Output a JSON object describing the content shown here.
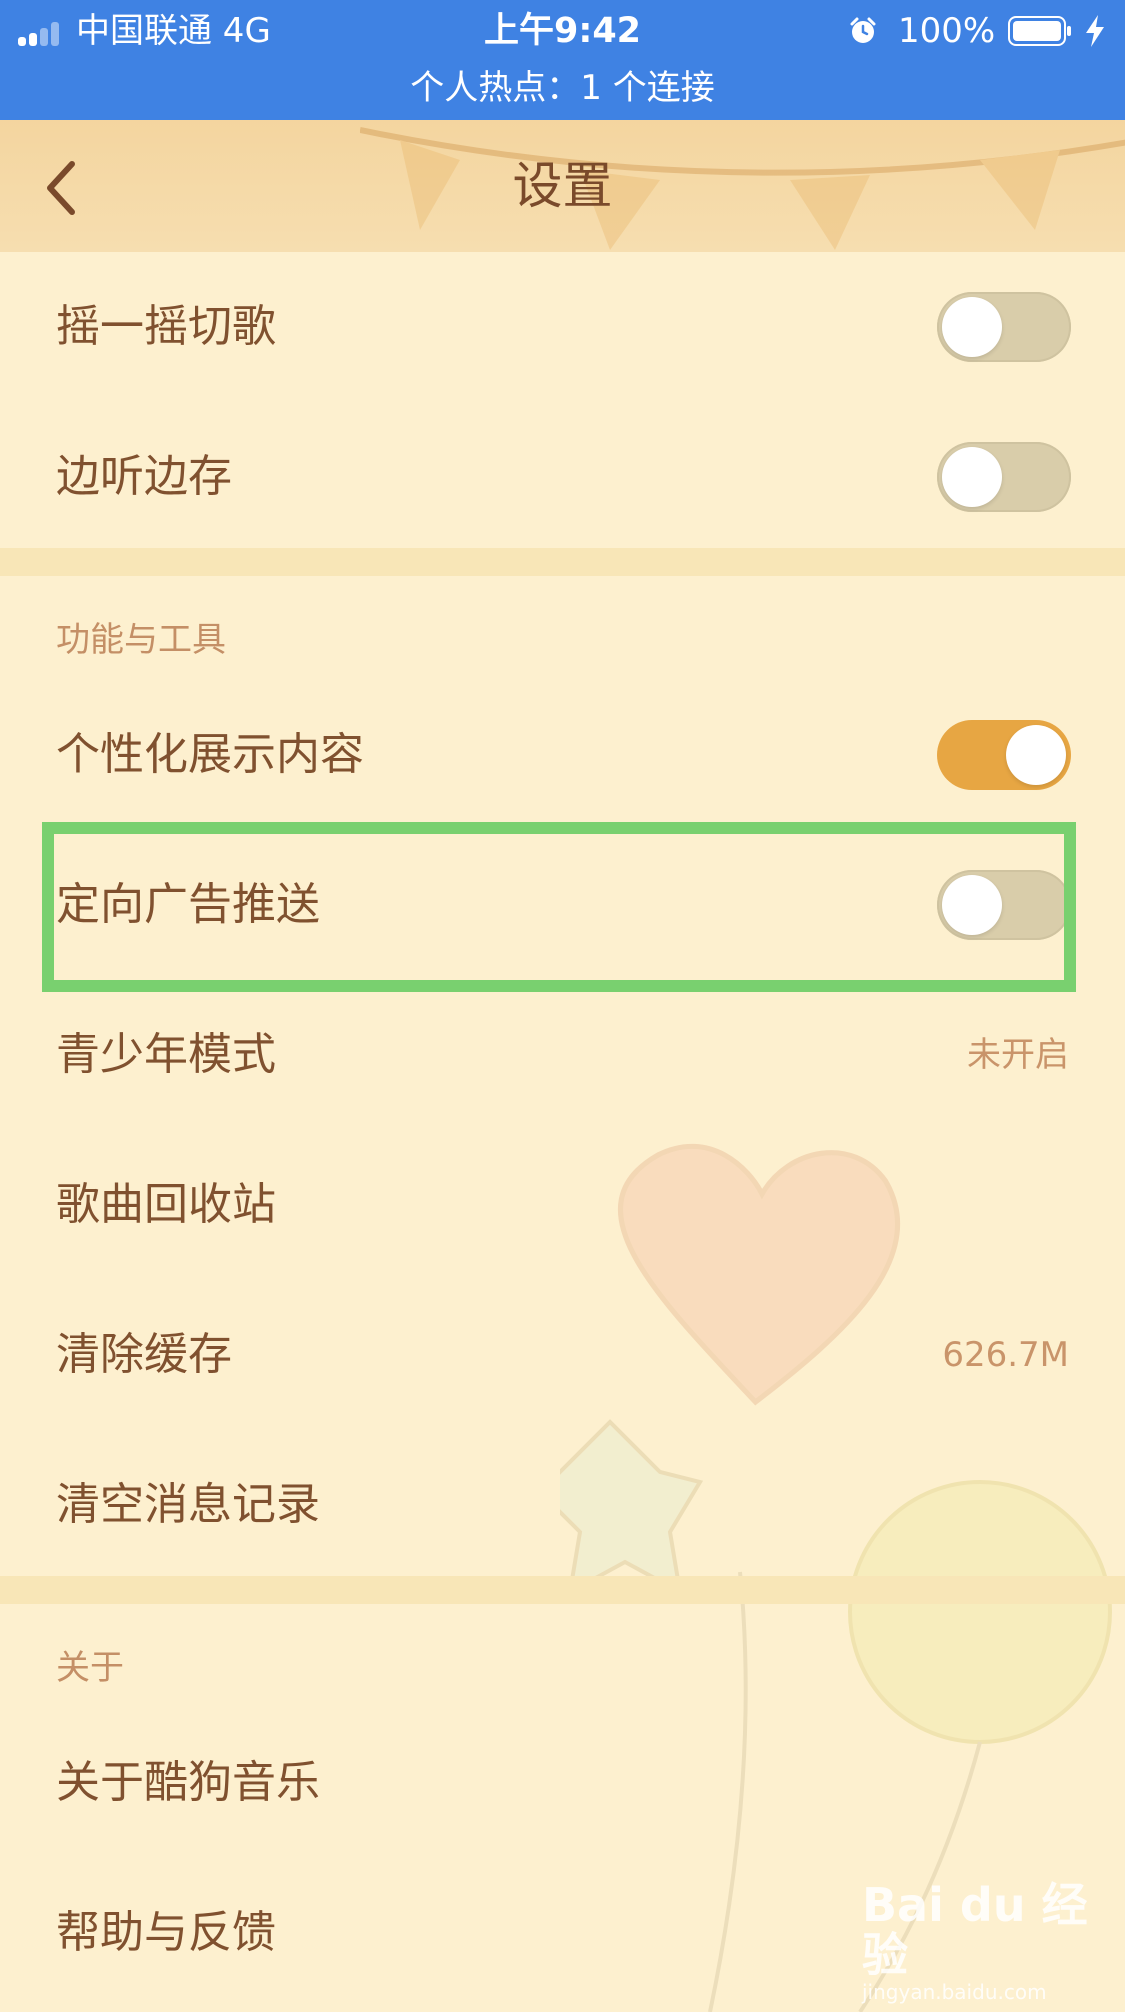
{
  "status_bar": {
    "carrier": "中国联通   4G",
    "time": "上午9:42",
    "battery": "100%",
    "hotspot": "个人热点：1 个连接",
    "color": "#3f82e3"
  },
  "header": {
    "title": "设置",
    "back_icon": "chevron-left-icon"
  },
  "settings_top": [
    {
      "label": "摇一摇切歌",
      "toggle_on": false
    },
    {
      "label": "边听边存",
      "toggle_on": false
    }
  ],
  "section_tools": {
    "title": "功能与工具",
    "items": [
      {
        "label": "个性化展示内容",
        "toggle_on": true
      },
      {
        "label": "定向广告推送",
        "toggle_on": false
      },
      {
        "label": "青少年模式",
        "value": "未开启"
      },
      {
        "label": "歌曲回收站"
      },
      {
        "label": "清除缓存",
        "value": "626.7M"
      },
      {
        "label": "清空消息记录"
      }
    ]
  },
  "section_about": {
    "title": "关于",
    "items": [
      {
        "label": "关于酷狗音乐"
      },
      {
        "label": "帮助与反馈"
      }
    ]
  },
  "watermark": {
    "logo": "Bai du 经验",
    "url": "jingyan.baidu.com"
  },
  "colors": {
    "accent": "#e7a643",
    "text": "#80512f",
    "highlight": "#79d06f"
  }
}
